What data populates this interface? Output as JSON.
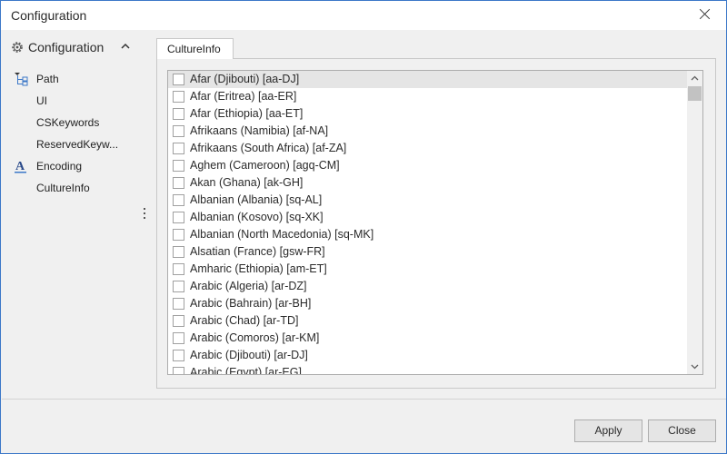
{
  "window": {
    "title": "Configuration"
  },
  "nav": {
    "header": "Configuration",
    "items": [
      {
        "label": "Path",
        "icon": "tree-icon"
      },
      {
        "label": "UI",
        "icon": ""
      },
      {
        "label": "CSKeywords",
        "icon": ""
      },
      {
        "label": "ReservedKeyw...",
        "icon": ""
      },
      {
        "label": "Encoding",
        "icon": "font-a-icon"
      },
      {
        "label": "CultureInfo",
        "icon": ""
      }
    ]
  },
  "tab": {
    "label": "CultureInfo"
  },
  "cultures": [
    "Afar (Djibouti) [aa-DJ]",
    "Afar (Eritrea) [aa-ER]",
    "Afar (Ethiopia) [aa-ET]",
    "Afrikaans (Namibia) [af-NA]",
    "Afrikaans (South Africa) [af-ZA]",
    "Aghem (Cameroon) [agq-CM]",
    "Akan (Ghana) [ak-GH]",
    "Albanian (Albania) [sq-AL]",
    "Albanian (Kosovo) [sq-XK]",
    "Albanian (North Macedonia) [sq-MK]",
    "Alsatian (France) [gsw-FR]",
    "Amharic (Ethiopia) [am-ET]",
    "Arabic (Algeria) [ar-DZ]",
    "Arabic (Bahrain) [ar-BH]",
    "Arabic (Chad) [ar-TD]",
    "Arabic (Comoros) [ar-KM]",
    "Arabic (Djibouti) [ar-DJ]",
    "Arabic (Egypt) [ar-EG]"
  ],
  "buttons": {
    "apply": "Apply",
    "close": "Close"
  },
  "colors": {
    "border": "#3c78c8",
    "selected_row": "#e5e5e5"
  }
}
